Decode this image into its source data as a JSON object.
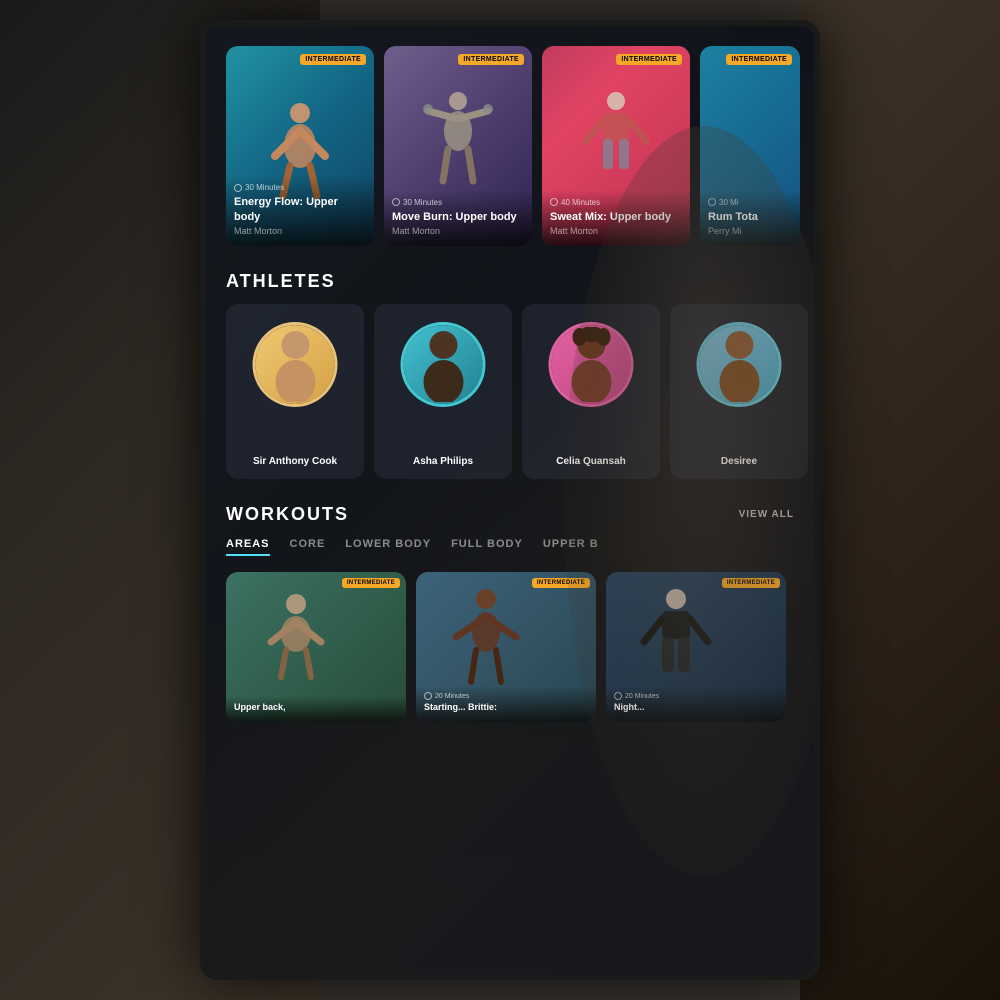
{
  "scene": {
    "bg_left": "dark background left person",
    "bg_right": "dark background right person"
  },
  "workout_cards": [
    {
      "id": "card-1",
      "badge": "Intermediate",
      "duration": "30 Minutes",
      "title": "Energy Flow: Upper body",
      "instructor": "Matt Morton",
      "bg_class": "card-bg-1"
    },
    {
      "id": "card-2",
      "badge": "Intermediate",
      "duration": "30 Minutes",
      "title": "Move Burn: Upper body",
      "instructor": "Matt Morton",
      "bg_class": "card-bg-2"
    },
    {
      "id": "card-3",
      "badge": "Intermediate",
      "duration": "40 Minutes",
      "title": "Sweat Mix: Upper body",
      "instructor": "Matt Morton",
      "bg_class": "card-bg-3"
    },
    {
      "id": "card-4",
      "badge": "Intermediate",
      "duration": "30 Mi",
      "title": "Rum Tota",
      "instructor": "Perry Mi",
      "bg_class": "card-bg-4"
    }
  ],
  "athletes_section": {
    "title": "ATHLETES",
    "athletes": [
      {
        "name": "Sir Anthony Cook",
        "ring_class": "avatar-ring-1",
        "bg_class": "avatar-bg-1",
        "emoji": "🧑"
      },
      {
        "name": "Asha Philips",
        "ring_class": "avatar-ring-2",
        "bg_class": "avatar-bg-2",
        "emoji": "👩"
      },
      {
        "name": "Celia Quansah",
        "ring_class": "avatar-ring-3",
        "bg_class": "avatar-bg-3",
        "emoji": "👩‍🦱"
      },
      {
        "name": "Desiree",
        "ring_class": "avatar-ring-4",
        "bg_class": "avatar-bg-4",
        "emoji": "👩"
      }
    ]
  },
  "workouts_section": {
    "title": "WORKOUTS",
    "view_all": "VIEW ALL",
    "filters": [
      {
        "label": "AREAS",
        "active": true
      },
      {
        "label": "CORE",
        "active": false
      },
      {
        "label": "LOWER BODY",
        "active": false
      },
      {
        "label": "FULL BODY",
        "active": false
      },
      {
        "label": "UPPER B",
        "active": false
      }
    ],
    "bottom_cards": [
      {
        "badge": "Intermediate",
        "duration": "",
        "title": "Upper back,",
        "bg_class": "bottom-card-bg-1"
      },
      {
        "badge": "Intermediate",
        "duration": "20 Minutes",
        "title": "Starting... Brittie:",
        "bg_class": "bottom-card-bg-2"
      },
      {
        "badge": "Intermediate",
        "duration": "20 Minutes",
        "title": "Night...",
        "bg_class": "bottom-card-bg-3"
      }
    ]
  }
}
